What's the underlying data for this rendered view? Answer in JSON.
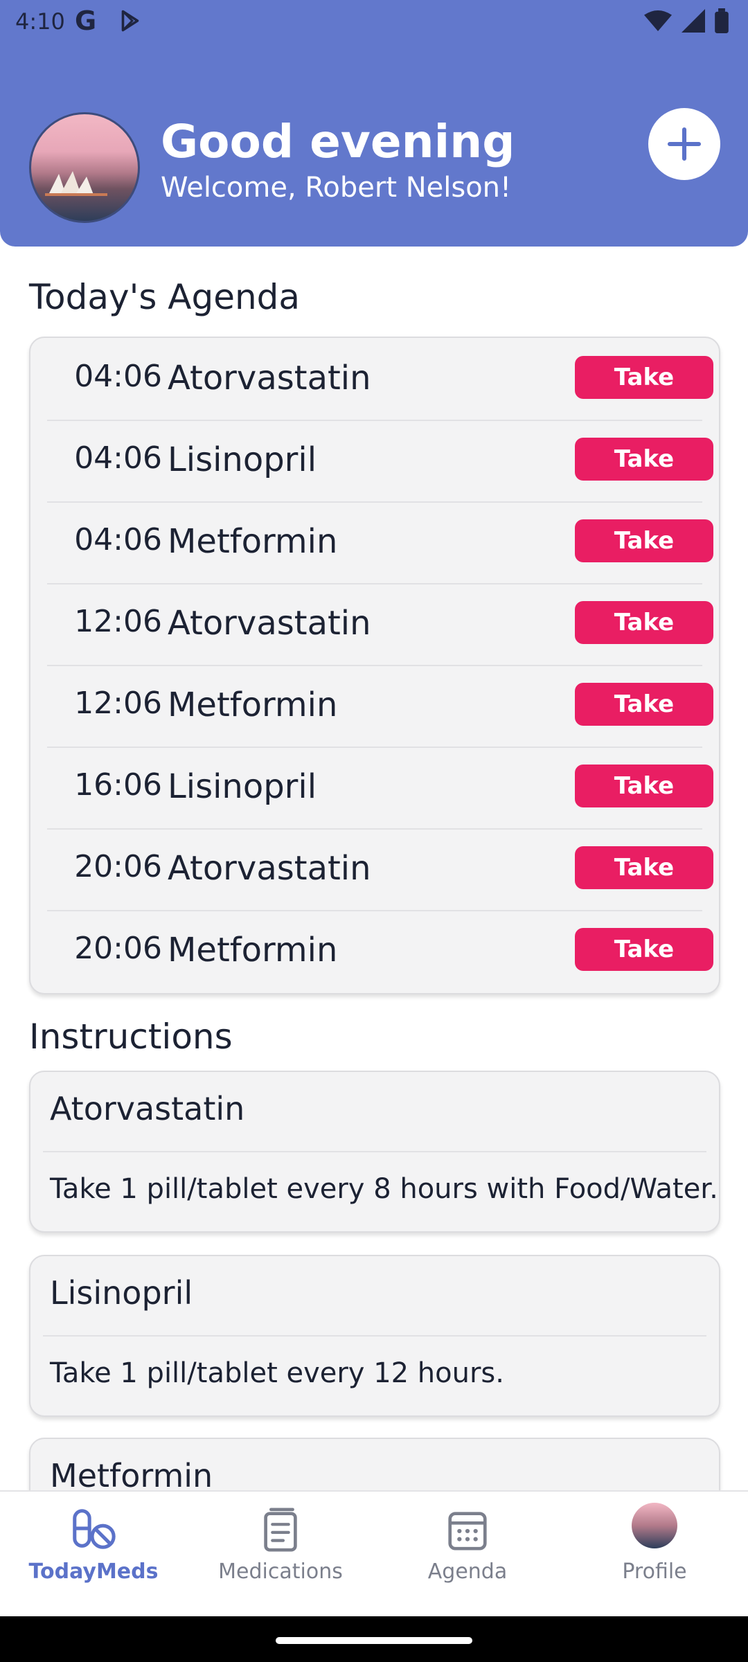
{
  "status_bar": {
    "time": "4:10",
    "google_glyph": "G"
  },
  "header": {
    "greeting": "Good evening",
    "welcome": "Welcome, Robert Nelson!",
    "add_icon": "plus-icon"
  },
  "agenda": {
    "title": "Today's Agenda",
    "items": [
      {
        "time": "04:06",
        "name": "Atorvastatin",
        "action": "Take"
      },
      {
        "time": "04:06",
        "name": "Lisinopril",
        "action": "Take"
      },
      {
        "time": "04:06",
        "name": "Metformin",
        "action": "Take"
      },
      {
        "time": "12:06",
        "name": "Atorvastatin",
        "action": "Take"
      },
      {
        "time": "12:06",
        "name": "Metformin",
        "action": "Take"
      },
      {
        "time": "16:06",
        "name": "Lisinopril",
        "action": "Take"
      },
      {
        "time": "20:06",
        "name": "Atorvastatin",
        "action": "Take"
      },
      {
        "time": "20:06",
        "name": "Metformin",
        "action": "Take"
      }
    ]
  },
  "instructions": {
    "title": "Instructions",
    "items": [
      {
        "name": "Atorvastatin",
        "text": "Take 1 pill/tablet every 8 hours with Food/Water."
      },
      {
        "name": "Lisinopril",
        "text": "Take 1 pill/tablet every 12 hours."
      },
      {
        "name": "Metformin",
        "text": ""
      }
    ]
  },
  "bottom_nav": {
    "items": [
      {
        "label": "TodayMeds",
        "icon": "pills-icon",
        "active": true
      },
      {
        "label": "Medications",
        "icon": "notebook-icon",
        "active": false
      },
      {
        "label": "Agenda",
        "icon": "calendar-icon",
        "active": false
      },
      {
        "label": "Profile",
        "icon": "avatar",
        "active": false
      }
    ]
  },
  "colors": {
    "header": "#6278cc",
    "take_button": "#e91e63",
    "active_nav": "#5b72c9"
  }
}
